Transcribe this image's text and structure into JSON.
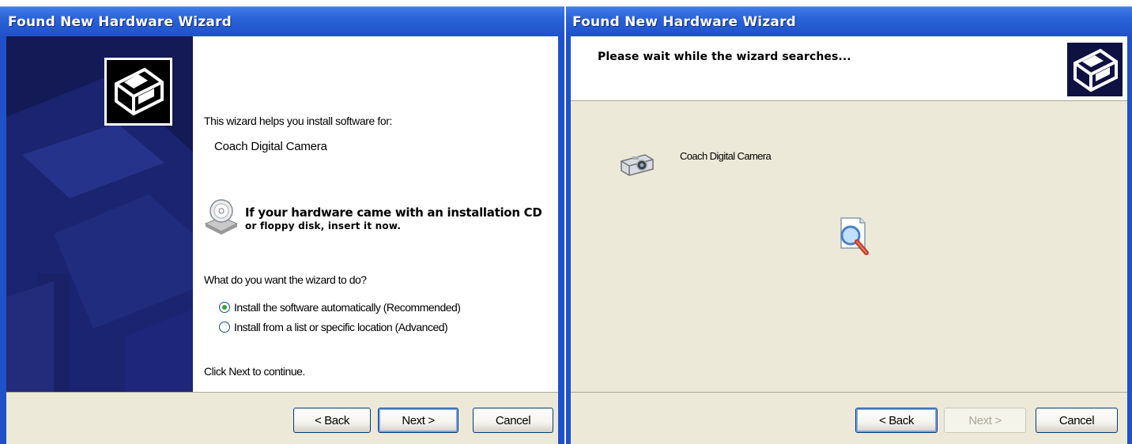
{
  "left_window": {
    "title": "Found New Hardware Wizard",
    "intro": "This wizard helps you install software for:",
    "device_name": "Coach Digital Camera",
    "cd_notice_line1": "If your hardware came with an installation CD",
    "cd_notice_line2": "or floppy disk, insert it now.",
    "question": "What do you want the wizard to do?",
    "options": [
      {
        "label": "Install the software automatically (Recommended)",
        "selected": true
      },
      {
        "label": "Install from a list or specific location (Advanced)",
        "selected": false
      }
    ],
    "continue_text": "Click Next to continue.",
    "buttons": {
      "back": "< Back",
      "next": "Next >",
      "cancel": "Cancel"
    },
    "icons": [
      "hardware-wizard-icon",
      "cd-icon"
    ]
  },
  "right_window": {
    "title": "Found New Hardware Wizard",
    "header_text": "Please wait while the wizard searches...",
    "device_name": "Coach Digital Camera",
    "buttons": {
      "back": "< Back",
      "next": "Next >",
      "cancel": "Cancel"
    },
    "next_enabled": false,
    "icons": [
      "hardware-wizard-icon",
      "camera-icon",
      "search-icon"
    ]
  },
  "colors": {
    "titlebar": "#2a62d8",
    "sidebar": "#141a56",
    "dialog_bg": "#ece9d8",
    "radio_selected": "#2fa82f"
  }
}
